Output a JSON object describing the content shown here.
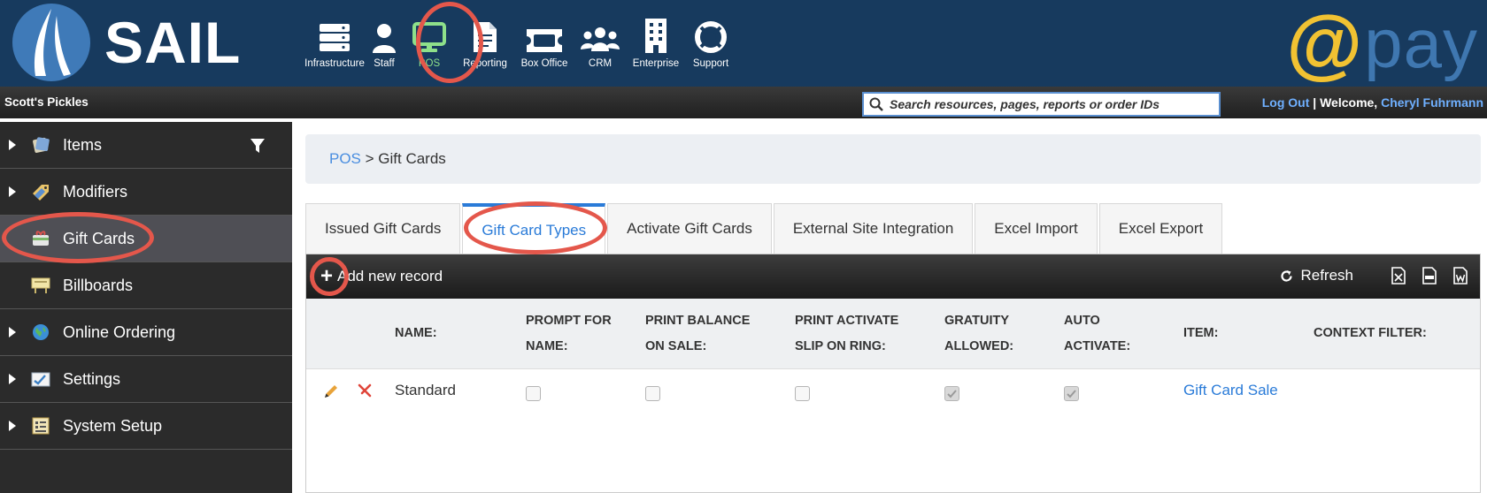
{
  "header": {
    "brand": "SAIL",
    "nav": [
      {
        "label": "Infrastructure",
        "icon": "server-icon",
        "active": false
      },
      {
        "label": "Staff",
        "icon": "user-icon",
        "active": false
      },
      {
        "label": "POS",
        "icon": "monitor-icon",
        "active": true
      },
      {
        "label": "Reporting",
        "icon": "document-icon",
        "active": false
      },
      {
        "label": "Box Office",
        "icon": "ticket-icon",
        "active": false
      },
      {
        "label": "CRM",
        "icon": "users-icon",
        "active": false
      },
      {
        "label": "Enterprise",
        "icon": "building-icon",
        "active": false
      },
      {
        "label": "Support",
        "icon": "lifebuoy-icon",
        "active": false
      }
    ],
    "pay_logo_at": "@",
    "pay_logo_word": "pay"
  },
  "subbar": {
    "org": "Scott's Pickles",
    "search_placeholder": "Search resources, pages, reports or order IDs",
    "logout": "Log Out",
    "separator": " | ",
    "welcome": "Welcome, ",
    "user": "Cheryl Fuhrmann"
  },
  "sidebar": {
    "items": [
      {
        "label": "Items",
        "icon": "items-icon",
        "expandable": true
      },
      {
        "label": "Modifiers",
        "icon": "modifiers-icon",
        "expandable": true
      },
      {
        "label": "Gift Cards",
        "icon": "gift-card-icon",
        "expandable": false,
        "selected": true
      },
      {
        "label": "Billboards",
        "icon": "billboard-icon",
        "expandable": false
      },
      {
        "label": "Online Ordering",
        "icon": "globe-icon",
        "expandable": true
      },
      {
        "label": "Settings",
        "icon": "settings-icon",
        "expandable": true
      },
      {
        "label": "System Setup",
        "icon": "system-setup-icon",
        "expandable": true
      }
    ]
  },
  "breadcrumb": {
    "root": "POS",
    "separator": " > ",
    "current": "Gift Cards"
  },
  "tabs": [
    {
      "label": "Issued Gift Cards",
      "active": false
    },
    {
      "label": "Gift Card Types",
      "active": true
    },
    {
      "label": "Activate Gift Cards",
      "active": false
    },
    {
      "label": "External Site Integration",
      "active": false
    },
    {
      "label": "Excel Import",
      "active": false
    },
    {
      "label": "Excel Export",
      "active": false
    }
  ],
  "toolbar": {
    "add_label": "Add new record",
    "refresh_label": "Refresh"
  },
  "table": {
    "columns": [
      "NAME:",
      "PROMPT FOR\nNAME:",
      "PRINT BALANCE\nON SALE:",
      "PRINT ACTIVATE\nSLIP ON RING:",
      "GRATUITY\nALLOWED:",
      "AUTO\nACTIVATE:",
      "ITEM:",
      "CONTEXT FILTER:"
    ],
    "rows": [
      {
        "name": "Standard",
        "prompt_for_name": false,
        "print_balance_on_sale": false,
        "print_activate_slip_on_ring": false,
        "gratuity_allowed": true,
        "auto_activate": true,
        "item": "Gift Card Sale",
        "context_filter": ""
      }
    ]
  },
  "colors": {
    "header_bg": "#173a5e",
    "accent": "#2a7bd8",
    "highlight": "#e4574b",
    "pay_yellow": "#f1c232"
  }
}
